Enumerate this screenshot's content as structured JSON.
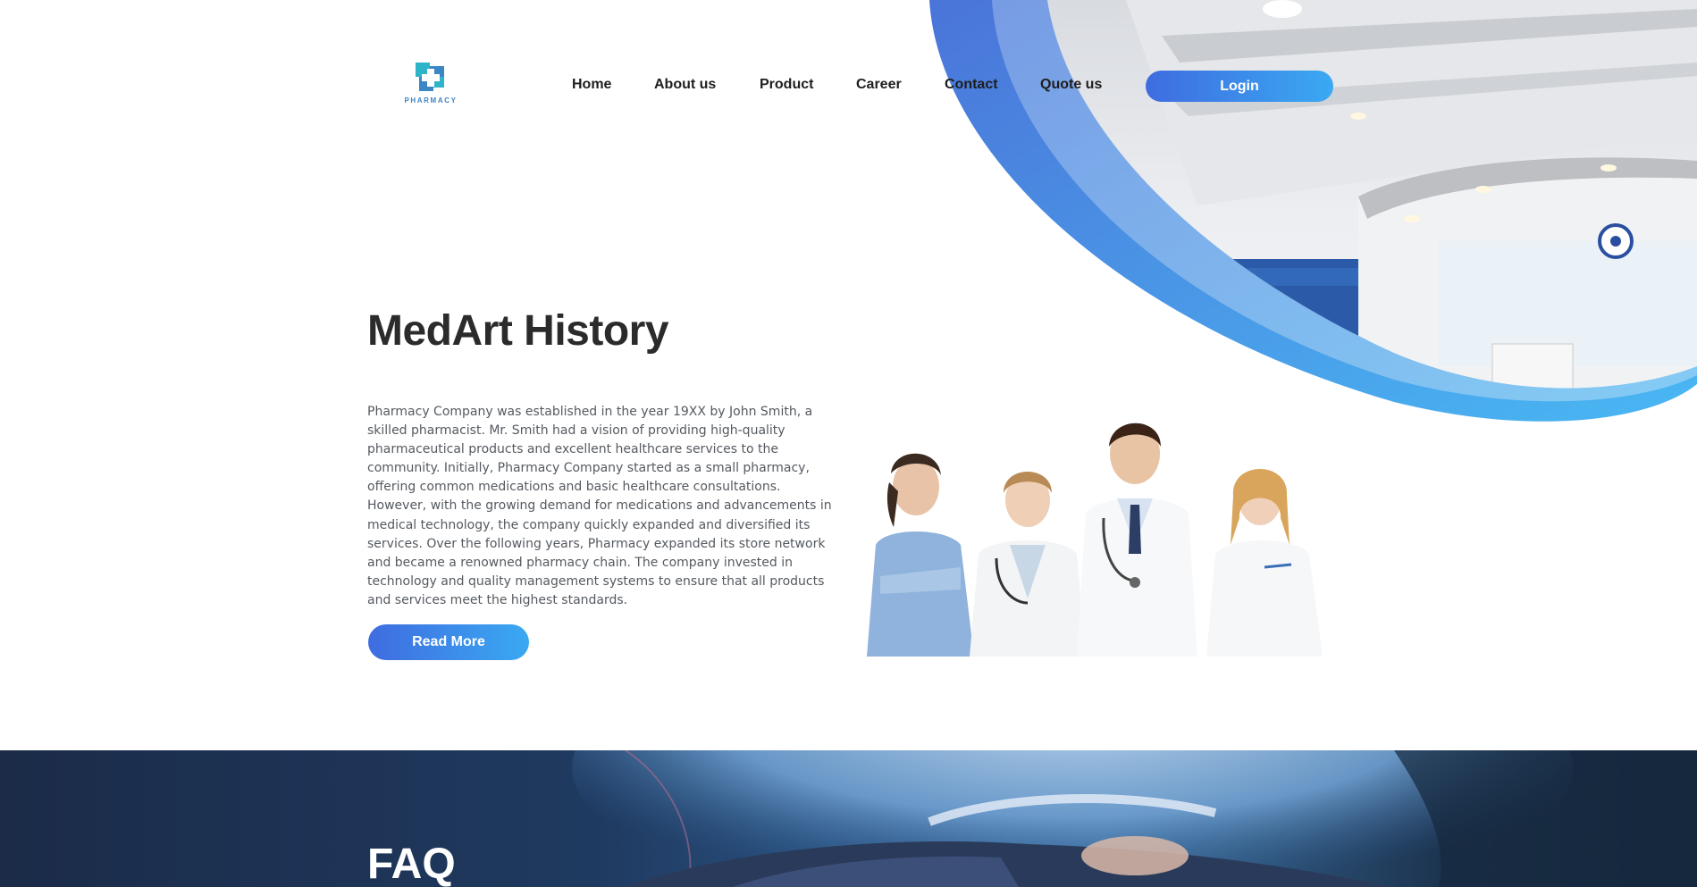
{
  "brand": {
    "logo_text": "PHARMACY"
  },
  "nav": {
    "items": [
      {
        "label": "Home"
      },
      {
        "label": "About us"
      },
      {
        "label": "Product"
      },
      {
        "label": "Career"
      },
      {
        "label": "Contact"
      },
      {
        "label": "Quote us"
      }
    ],
    "login_label": "Login"
  },
  "history": {
    "title": "MedArt History",
    "body": "Pharmacy Company was established in the year 19XX by John Smith, a skilled pharmacist. Mr. Smith had a vision of providing high-quality pharmaceutical products and excellent healthcare services to the community. Initially, Pharmacy Company started as a small pharmacy, offering common medications and basic healthcare consultations. However, with the growing demand for medications and advancements in medical technology, the company quickly expanded and diversified its services. Over the following years, Pharmacy expanded its store network and became a renowned pharmacy chain. The company invested in technology and quality management systems to ensure that all products and services meet the highest standards.",
    "read_more_label": "Read More"
  },
  "faq": {
    "title": "FAQ"
  },
  "colors": {
    "accent_start": "#3f6ce0",
    "accent_end": "#3aa9f2",
    "faq_background": "#1b2b48",
    "logo_blue": "#3b86c4",
    "logo_teal": "#2fb3c9"
  },
  "icons": {
    "logo": "pharmacy-cross-icon"
  }
}
